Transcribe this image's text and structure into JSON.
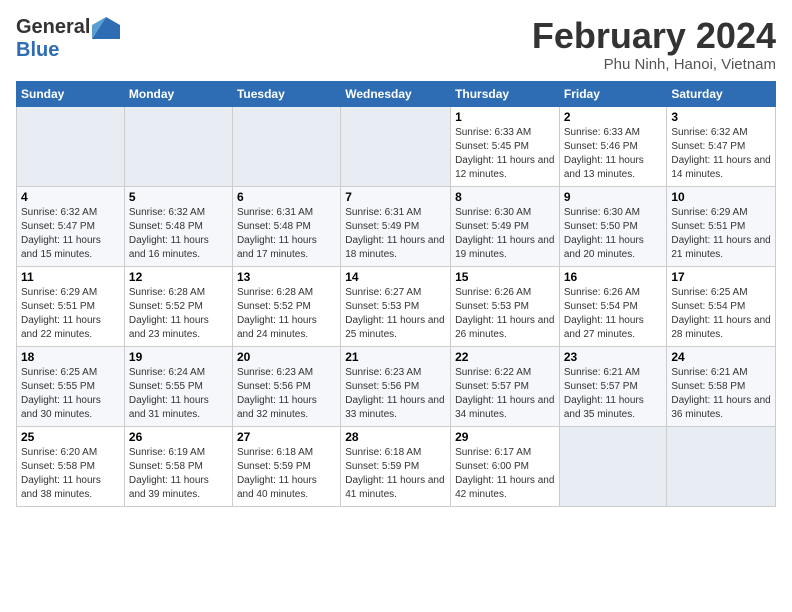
{
  "logo": {
    "general": "General",
    "blue": "Blue"
  },
  "title": {
    "month": "February 2024",
    "location": "Phu Ninh, Hanoi, Vietnam"
  },
  "headers": [
    "Sunday",
    "Monday",
    "Tuesday",
    "Wednesday",
    "Thursday",
    "Friday",
    "Saturday"
  ],
  "weeks": [
    [
      {
        "day": "",
        "sunrise": "",
        "sunset": "",
        "daylight": ""
      },
      {
        "day": "",
        "sunrise": "",
        "sunset": "",
        "daylight": ""
      },
      {
        "day": "",
        "sunrise": "",
        "sunset": "",
        "daylight": ""
      },
      {
        "day": "",
        "sunrise": "",
        "sunset": "",
        "daylight": ""
      },
      {
        "day": "1",
        "sunrise": "Sunrise: 6:33 AM",
        "sunset": "Sunset: 5:45 PM",
        "daylight": "Daylight: 11 hours and 12 minutes."
      },
      {
        "day": "2",
        "sunrise": "Sunrise: 6:33 AM",
        "sunset": "Sunset: 5:46 PM",
        "daylight": "Daylight: 11 hours and 13 minutes."
      },
      {
        "day": "3",
        "sunrise": "Sunrise: 6:32 AM",
        "sunset": "Sunset: 5:47 PM",
        "daylight": "Daylight: 11 hours and 14 minutes."
      }
    ],
    [
      {
        "day": "4",
        "sunrise": "Sunrise: 6:32 AM",
        "sunset": "Sunset: 5:47 PM",
        "daylight": "Daylight: 11 hours and 15 minutes."
      },
      {
        "day": "5",
        "sunrise": "Sunrise: 6:32 AM",
        "sunset": "Sunset: 5:48 PM",
        "daylight": "Daylight: 11 hours and 16 minutes."
      },
      {
        "day": "6",
        "sunrise": "Sunrise: 6:31 AM",
        "sunset": "Sunset: 5:48 PM",
        "daylight": "Daylight: 11 hours and 17 minutes."
      },
      {
        "day": "7",
        "sunrise": "Sunrise: 6:31 AM",
        "sunset": "Sunset: 5:49 PM",
        "daylight": "Daylight: 11 hours and 18 minutes."
      },
      {
        "day": "8",
        "sunrise": "Sunrise: 6:30 AM",
        "sunset": "Sunset: 5:49 PM",
        "daylight": "Daylight: 11 hours and 19 minutes."
      },
      {
        "day": "9",
        "sunrise": "Sunrise: 6:30 AM",
        "sunset": "Sunset: 5:50 PM",
        "daylight": "Daylight: 11 hours and 20 minutes."
      },
      {
        "day": "10",
        "sunrise": "Sunrise: 6:29 AM",
        "sunset": "Sunset: 5:51 PM",
        "daylight": "Daylight: 11 hours and 21 minutes."
      }
    ],
    [
      {
        "day": "11",
        "sunrise": "Sunrise: 6:29 AM",
        "sunset": "Sunset: 5:51 PM",
        "daylight": "Daylight: 11 hours and 22 minutes."
      },
      {
        "day": "12",
        "sunrise": "Sunrise: 6:28 AM",
        "sunset": "Sunset: 5:52 PM",
        "daylight": "Daylight: 11 hours and 23 minutes."
      },
      {
        "day": "13",
        "sunrise": "Sunrise: 6:28 AM",
        "sunset": "Sunset: 5:52 PM",
        "daylight": "Daylight: 11 hours and 24 minutes."
      },
      {
        "day": "14",
        "sunrise": "Sunrise: 6:27 AM",
        "sunset": "Sunset: 5:53 PM",
        "daylight": "Daylight: 11 hours and 25 minutes."
      },
      {
        "day": "15",
        "sunrise": "Sunrise: 6:26 AM",
        "sunset": "Sunset: 5:53 PM",
        "daylight": "Daylight: 11 hours and 26 minutes."
      },
      {
        "day": "16",
        "sunrise": "Sunrise: 6:26 AM",
        "sunset": "Sunset: 5:54 PM",
        "daylight": "Daylight: 11 hours and 27 minutes."
      },
      {
        "day": "17",
        "sunrise": "Sunrise: 6:25 AM",
        "sunset": "Sunset: 5:54 PM",
        "daylight": "Daylight: 11 hours and 28 minutes."
      }
    ],
    [
      {
        "day": "18",
        "sunrise": "Sunrise: 6:25 AM",
        "sunset": "Sunset: 5:55 PM",
        "daylight": "Daylight: 11 hours and 30 minutes."
      },
      {
        "day": "19",
        "sunrise": "Sunrise: 6:24 AM",
        "sunset": "Sunset: 5:55 PM",
        "daylight": "Daylight: 11 hours and 31 minutes."
      },
      {
        "day": "20",
        "sunrise": "Sunrise: 6:23 AM",
        "sunset": "Sunset: 5:56 PM",
        "daylight": "Daylight: 11 hours and 32 minutes."
      },
      {
        "day": "21",
        "sunrise": "Sunrise: 6:23 AM",
        "sunset": "Sunset: 5:56 PM",
        "daylight": "Daylight: 11 hours and 33 minutes."
      },
      {
        "day": "22",
        "sunrise": "Sunrise: 6:22 AM",
        "sunset": "Sunset: 5:57 PM",
        "daylight": "Daylight: 11 hours and 34 minutes."
      },
      {
        "day": "23",
        "sunrise": "Sunrise: 6:21 AM",
        "sunset": "Sunset: 5:57 PM",
        "daylight": "Daylight: 11 hours and 35 minutes."
      },
      {
        "day": "24",
        "sunrise": "Sunrise: 6:21 AM",
        "sunset": "Sunset: 5:58 PM",
        "daylight": "Daylight: 11 hours and 36 minutes."
      }
    ],
    [
      {
        "day": "25",
        "sunrise": "Sunrise: 6:20 AM",
        "sunset": "Sunset: 5:58 PM",
        "daylight": "Daylight: 11 hours and 38 minutes."
      },
      {
        "day": "26",
        "sunrise": "Sunrise: 6:19 AM",
        "sunset": "Sunset: 5:58 PM",
        "daylight": "Daylight: 11 hours and 39 minutes."
      },
      {
        "day": "27",
        "sunrise": "Sunrise: 6:18 AM",
        "sunset": "Sunset: 5:59 PM",
        "daylight": "Daylight: 11 hours and 40 minutes."
      },
      {
        "day": "28",
        "sunrise": "Sunrise: 6:18 AM",
        "sunset": "Sunset: 5:59 PM",
        "daylight": "Daylight: 11 hours and 41 minutes."
      },
      {
        "day": "29",
        "sunrise": "Sunrise: 6:17 AM",
        "sunset": "Sunset: 6:00 PM",
        "daylight": "Daylight: 11 hours and 42 minutes."
      },
      {
        "day": "",
        "sunrise": "",
        "sunset": "",
        "daylight": ""
      },
      {
        "day": "",
        "sunrise": "",
        "sunset": "",
        "daylight": ""
      }
    ]
  ]
}
